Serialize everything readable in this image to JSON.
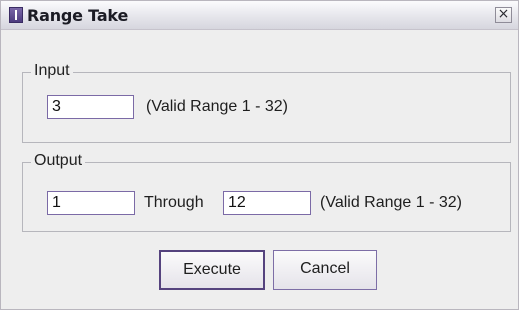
{
  "window": {
    "title": "Range Take",
    "close_glyph": "×",
    "accent": "#55437e"
  },
  "input_group": {
    "legend": "Input",
    "value": "3",
    "range_text": "(Valid Range 1 - 32)"
  },
  "output_group": {
    "legend": "Output",
    "from_value": "1",
    "through_label": "Through",
    "to_value": "12",
    "range_text": "(Valid Range 1 - 32)"
  },
  "buttons": {
    "execute_label": "Execute",
    "cancel_label": "Cancel"
  },
  "icons": {
    "app": "app-icon",
    "close": "close-icon"
  }
}
